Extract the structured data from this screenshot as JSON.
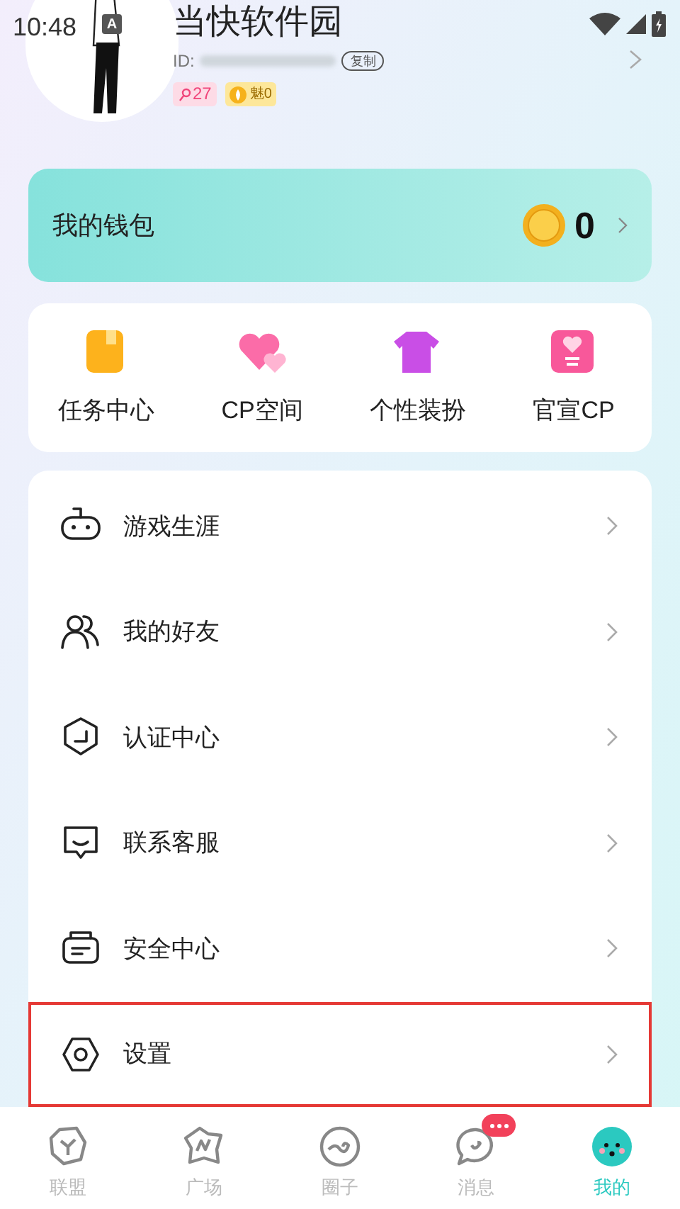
{
  "status_bar": {
    "time": "10:48",
    "badge": "A"
  },
  "profile": {
    "name": "当快软件园",
    "id_label": "ID:",
    "copy_button": "复制",
    "level_badge": "27",
    "charm_badge": "魅0"
  },
  "wallet": {
    "title": "我的钱包",
    "coins": "0"
  },
  "shortcuts": [
    {
      "label": "任务中心",
      "kind": "task"
    },
    {
      "label": "CP空间",
      "kind": "hearts"
    },
    {
      "label": "个性装扮",
      "kind": "shirt"
    },
    {
      "label": "官宣CP",
      "kind": "card"
    }
  ],
  "menu": [
    {
      "label": "游戏生涯",
      "kind": "game",
      "highlighted": false
    },
    {
      "label": "我的好友",
      "kind": "friends",
      "highlighted": false
    },
    {
      "label": "认证中心",
      "kind": "verify",
      "highlighted": false
    },
    {
      "label": "联系客服",
      "kind": "service",
      "highlighted": false
    },
    {
      "label": "安全中心",
      "kind": "security",
      "highlighted": false
    },
    {
      "label": "设置",
      "kind": "settings",
      "highlighted": true
    }
  ],
  "tabs": [
    {
      "label": "联盟",
      "kind": "alliance",
      "selected": false,
      "badge": false
    },
    {
      "label": "广场",
      "kind": "square",
      "selected": false,
      "badge": false
    },
    {
      "label": "圈子",
      "kind": "circle",
      "selected": false,
      "badge": false
    },
    {
      "label": "消息",
      "kind": "message",
      "selected": false,
      "badge": true
    },
    {
      "label": "我的",
      "kind": "me",
      "selected": true,
      "badge": false
    }
  ]
}
